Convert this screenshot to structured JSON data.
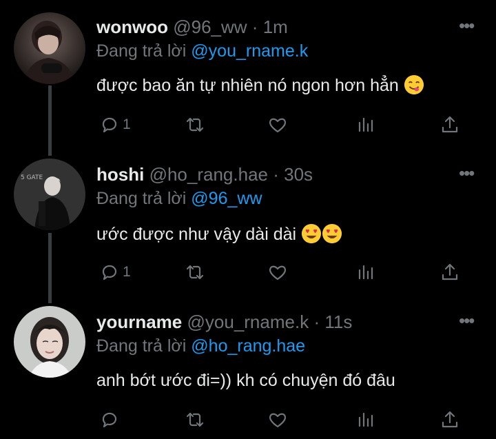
{
  "tweets": [
    {
      "name": "wonwoo",
      "handle": "@96_ww",
      "separator": "·",
      "time": "1m",
      "reply_prefix": "Đang trả lời",
      "reply_to": "@you_rname.k",
      "text": "được bao ăn tự nhiên nó ngon hơn hẳn",
      "emoji": [
        "savoring-face-emoji"
      ],
      "reply_count": "1"
    },
    {
      "name": "hoshi",
      "handle": "@ho_rang.hae",
      "separator": "·",
      "time": "30s",
      "reply_prefix": "Đang trả lời",
      "reply_to": "@96_ww",
      "text": "ước được như vậy dài dài",
      "emoji": [
        "heart-eyes-emoji",
        "heart-eyes-emoji"
      ],
      "reply_count": "1",
      "avatar_text": "5 GATE"
    },
    {
      "name": "yourname",
      "handle": "@you_rname.k",
      "separator": "·",
      "time": "11s",
      "reply_prefix": "Đang trả lời",
      "reply_to": "@ho_rang.hae",
      "text": "anh bớt ước đi=)) kh có chuyện đó đâu",
      "emoji": [],
      "reply_count": ""
    }
  ],
  "icons": {
    "more": "more-options-icon",
    "reply": "reply-icon",
    "retweet": "retweet-icon",
    "like": "like-icon",
    "views": "views-icon",
    "share": "share-icon"
  },
  "colors": {
    "background": "#000000",
    "text": "#e7e9ea",
    "muted": "#71767b",
    "mention": "#1d9bf0",
    "thread_line": "#3a3d40"
  }
}
